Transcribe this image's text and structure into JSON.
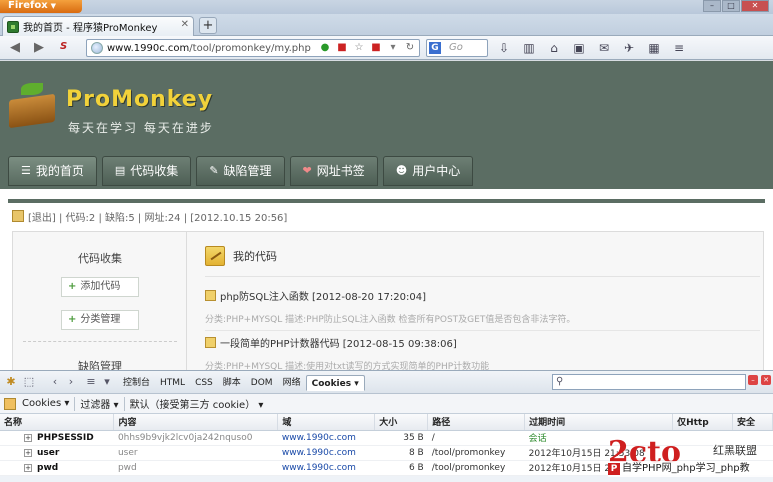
{
  "browser": {
    "app_button": "Firefox",
    "tab_title": "我的首页 - 程序猿ProMonkey",
    "new_tab": "+",
    "url_host": "www.1990c.com",
    "url_path": "/tool/promonkey/my.php",
    "search_placeholder": "Go",
    "search_engine_icon": "G"
  },
  "site": {
    "logo_text": "ProMonkey",
    "slogan": "每天在学习 每天在进步",
    "menu": [
      {
        "label": "我的首页",
        "icon": "☰"
      },
      {
        "label": "代码收集",
        "icon": "▤"
      },
      {
        "label": "缺陷管理",
        "icon": "✎"
      },
      {
        "label": "网址书签",
        "icon": "❤"
      },
      {
        "label": "用户中心",
        "icon": "☻"
      }
    ],
    "info": "[退出] | 代码:2 | 缺陷:5 | 网址:24 | [2012.10.15 20:56]",
    "sidebar": {
      "section1_title": "代码收集",
      "add_code": "添加代码",
      "manage_categories": "分类管理",
      "section2_title": "缺陷管理"
    },
    "main_title": "我的代码",
    "articles": [
      {
        "title": "php防SQL注入函数 [2012-08-20 17:20:04]",
        "meta": "分类:PHP+MYSQL    描述:PHP防止SQL注入函数 检查所有POST及GET值是否包含非法字符。"
      },
      {
        "title": "一段简单的PHP计数器代码 [2012-08-15 09:38:06]",
        "meta": "分类:PHP+MYSQL    描述:使用对txt读写的方式实现简单的PHP计数功能"
      }
    ]
  },
  "firebug": {
    "tabs": [
      "控制台",
      "HTML",
      "CSS",
      "脚本",
      "DOM",
      "网络",
      "Cookies"
    ],
    "active_tab": "Cookies",
    "search_icon": "⚲",
    "subbar": {
      "cookies_menu": "Cookies",
      "filter_menu": "过滤器",
      "default_menu": "默认（接受第三方 cookie）"
    },
    "columns": [
      "名称",
      "内容",
      "域",
      "大小",
      "路径",
      "过期时间",
      "仅Http",
      "安全"
    ],
    "rows": [
      {
        "name": "PHPSESSID",
        "value": "0hhs9b9vjk2lcv0ja242nquso0",
        "domain": "www.1990c.com",
        "size": "35 B",
        "path": "/",
        "expires": "会话",
        "http": "",
        "secure": ""
      },
      {
        "name": "user",
        "value": "user",
        "domain": "www.1990c.com",
        "size": "8 B",
        "path": "/tool/promonkey",
        "expires": "2012年10月15日 21:53:08",
        "http": "",
        "secure": ""
      },
      {
        "name": "pwd",
        "value": "pwd",
        "domain": "www.1990c.com",
        "size": "6 B",
        "path": "/tool/promonkey",
        "expires": "2012年10月15日 2",
        "http": "",
        "secure": ""
      }
    ]
  },
  "watermark": {
    "logo": "2cto",
    "side_text": "红黑联盟",
    "bar_icon": "P",
    "bar_text": "自学PHP网_php学习_php教"
  }
}
